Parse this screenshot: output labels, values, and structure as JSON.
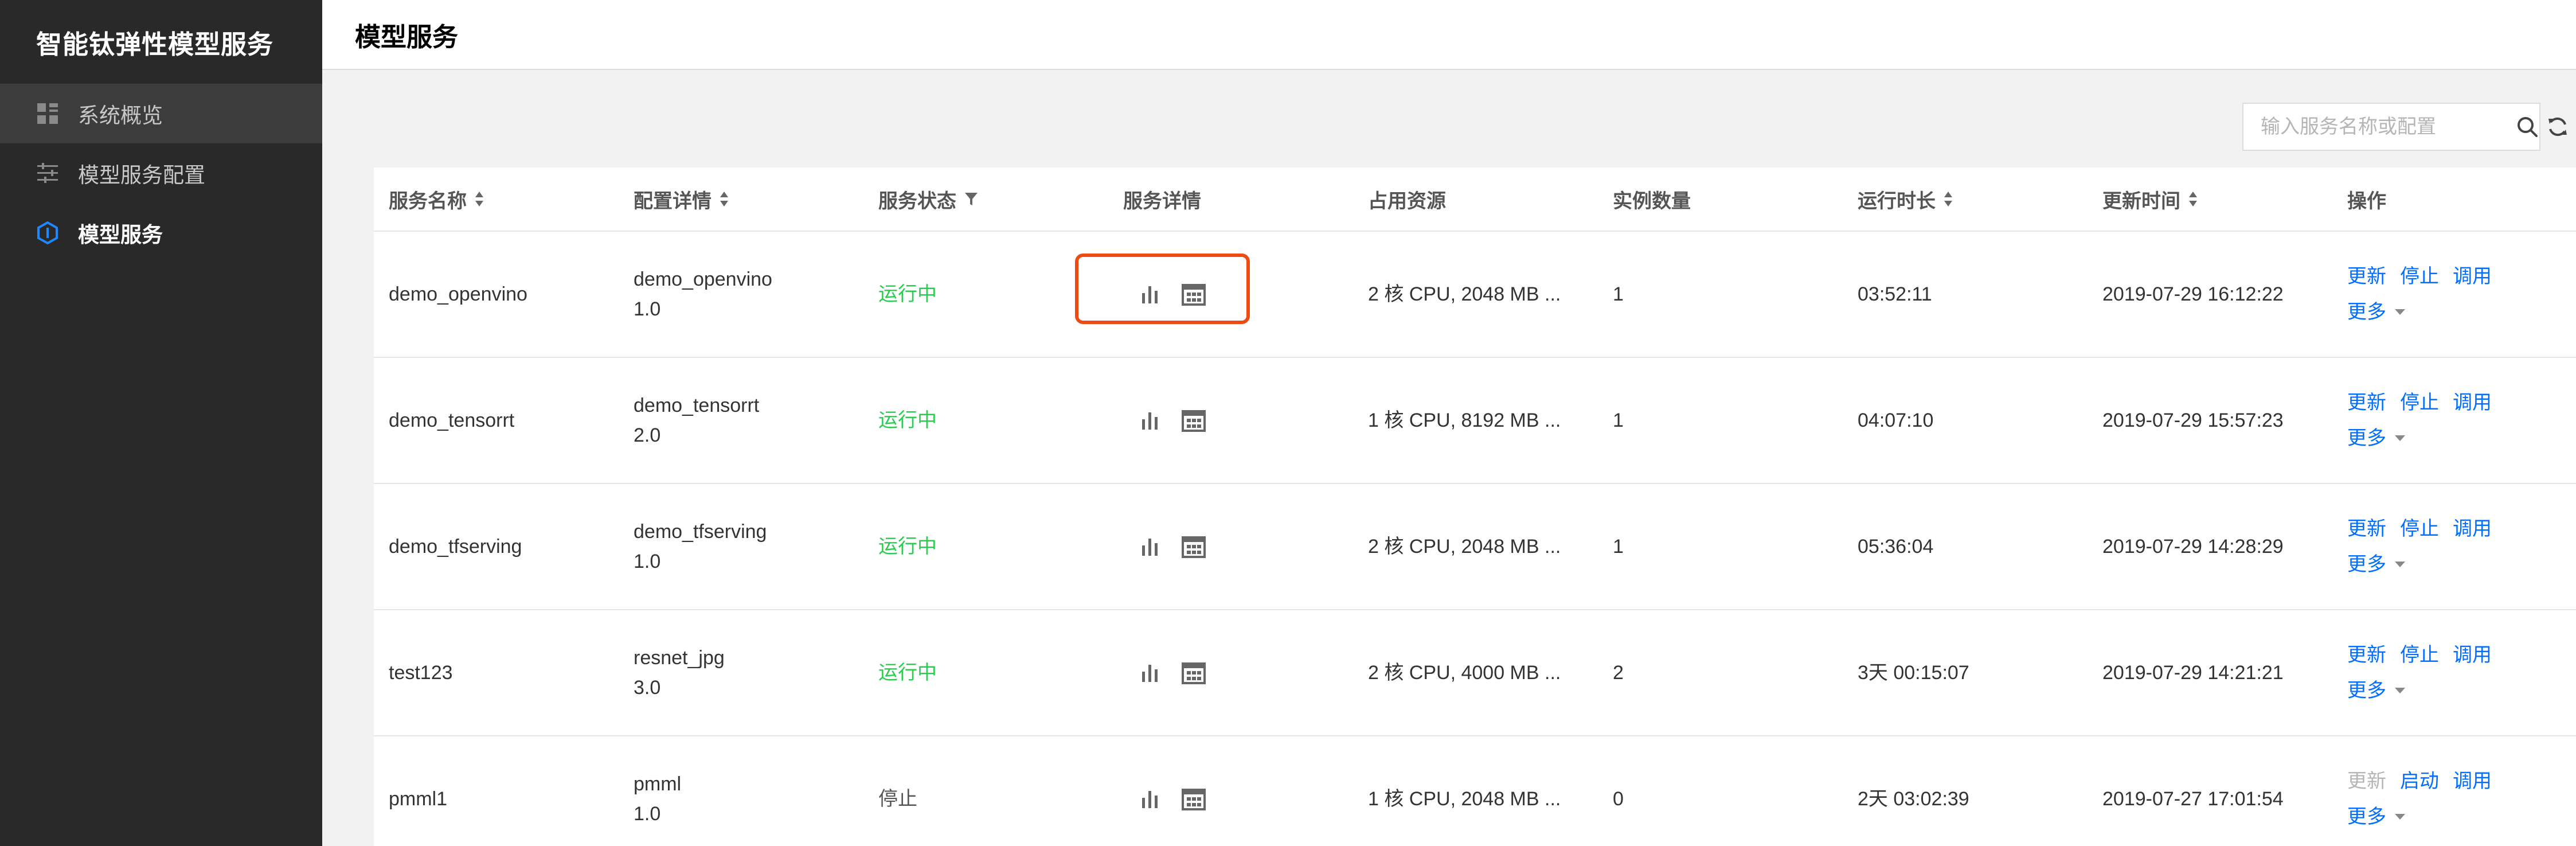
{
  "sidebar": {
    "brand": "智能钛弹性模型服务",
    "items": [
      {
        "label": "系统概览",
        "icon": "grid-icon"
      },
      {
        "label": "模型服务配置",
        "icon": "sliders-icon"
      },
      {
        "label": "模型服务",
        "icon": "cube-icon"
      }
    ]
  },
  "header": {
    "title": "模型服务"
  },
  "search": {
    "placeholder": "输入服务名称或配置"
  },
  "table": {
    "columns": [
      "服务名称",
      "配置详情",
      "服务状态",
      "服务详情",
      "占用资源",
      "实例数量",
      "运行时长",
      "更新时间",
      "操作"
    ],
    "rows": [
      {
        "name": "demo_openvino",
        "config": "demo_openvino",
        "version": "1.0",
        "status": "运行中",
        "resources": "2 核 CPU, 2048 MB ...",
        "instances": "1",
        "runtime": "03:52:11",
        "updated": "2019-07-29 16:12:22",
        "op1": "更新",
        "op2": "停止",
        "op3": "调用",
        "more": "更多"
      },
      {
        "name": "demo_tensorrt",
        "config": "demo_tensorrt",
        "version": "2.0",
        "status": "运行中",
        "resources": "1 核 CPU, 8192 MB ...",
        "instances": "1",
        "runtime": "04:07:10",
        "updated": "2019-07-29 15:57:23",
        "op1": "更新",
        "op2": "停止",
        "op3": "调用",
        "more": "更多"
      },
      {
        "name": "demo_tfserving",
        "config": "demo_tfserving",
        "version": "1.0",
        "status": "运行中",
        "resources": "2 核 CPU, 2048 MB ...",
        "instances": "1",
        "runtime": "05:36:04",
        "updated": "2019-07-29 14:28:29",
        "op1": "更新",
        "op2": "停止",
        "op3": "调用",
        "more": "更多"
      },
      {
        "name": "test123",
        "config": "resnet_jpg",
        "version": "3.0",
        "status": "运行中",
        "resources": "2 核 CPU, 4000 MB ...",
        "instances": "2",
        "runtime": "3天 00:15:07",
        "updated": "2019-07-29 14:21:21",
        "op1": "更新",
        "op2": "停止",
        "op3": "调用",
        "more": "更多"
      },
      {
        "name": "pmml1",
        "config": "pmml",
        "version": "1.0",
        "status": "停止",
        "resources": "1 核 CPU, 2048 MB ...",
        "instances": "0",
        "runtime": "2天 03:02:39",
        "updated": "2019-07-27 17:01:54",
        "op1": "更新",
        "op2": "启动",
        "op3": "调用",
        "more": "更多"
      }
    ]
  },
  "colors": {
    "running": "#29cc4f",
    "link": "#006eff",
    "highlight": "#f04a13",
    "sidebar": "#292929"
  }
}
